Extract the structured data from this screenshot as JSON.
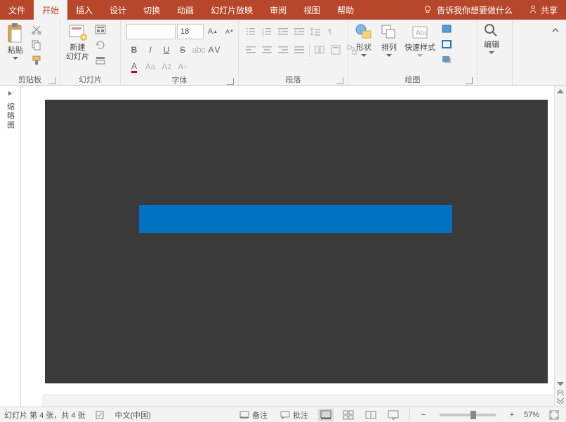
{
  "tabs": {
    "file": "文件",
    "home": "开始",
    "insert": "插入",
    "design": "设计",
    "transitions": "切换",
    "animations": "动画",
    "slideshow": "幻灯片放映",
    "review": "审阅",
    "view": "视图",
    "help": "帮助"
  },
  "tellme": "告诉我你想要做什么",
  "share": "共享",
  "groups": {
    "clipboard": "剪贴板",
    "slides": "幻灯片",
    "font": "字体",
    "paragraph": "段落",
    "drawing": "绘图",
    "editing": "编辑"
  },
  "buttons": {
    "paste": "粘贴",
    "new_slide": "新建\n幻灯片",
    "shapes": "形状",
    "arrange": "排列",
    "quick_styles": "快速样式"
  },
  "font": {
    "name": "",
    "size": "18"
  },
  "outline_label": "缩略图",
  "status": {
    "slide_info": "幻灯片 第 4 张，共 4 张",
    "language": "中文(中国)",
    "notes": "备注",
    "comments": "批注",
    "zoom": "57%"
  }
}
